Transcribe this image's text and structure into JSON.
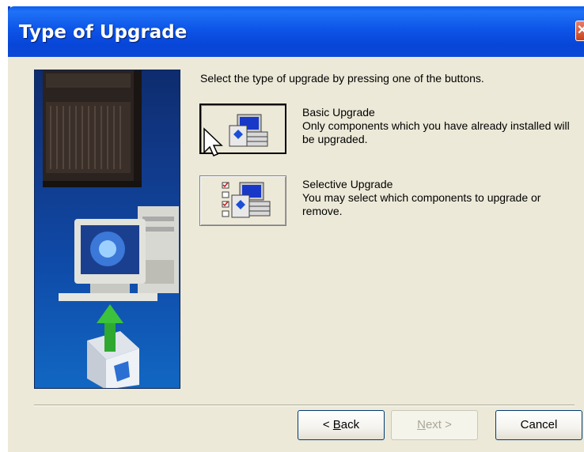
{
  "window": {
    "title": "Type of Upgrade",
    "close_glyph": "✕"
  },
  "main": {
    "instruction": "Select the type of upgrade by pressing one of the buttons.",
    "options": [
      {
        "title": "Basic Upgrade",
        "description": "Only components which you have already installed will be upgraded.",
        "icon": "computer-with-disk-icon",
        "state": "pressed"
      },
      {
        "title": "Selective Upgrade",
        "description": "You may select which components to upgrade or remove.",
        "icon": "checklist-computer-icon",
        "state": "normal"
      }
    ]
  },
  "footer": {
    "back_prefix": "< ",
    "back_mnemonic": "B",
    "back_rest": "ack",
    "next_mnemonic": "N",
    "next_rest": "ext >",
    "cancel_label": "Cancel"
  },
  "colors": {
    "titlebar": "#0a50e0",
    "dialog_bg": "#ece9d8",
    "side_panel": "#113a8a"
  }
}
